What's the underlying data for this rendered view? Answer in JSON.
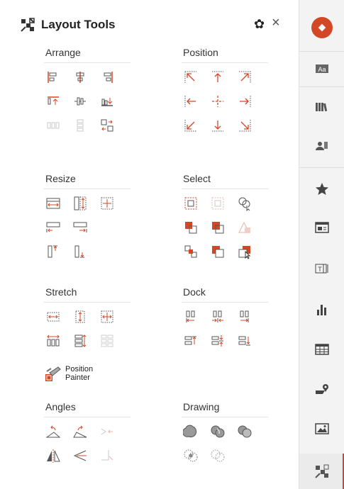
{
  "header": {
    "title": "Layout Tools",
    "logo_icon": "layout-tools-icon",
    "settings_icon": "gear-icon",
    "close_icon": "close-icon",
    "close_glyph": "×",
    "gear_glyph": "✿"
  },
  "colors": {
    "accent": "#d24726",
    "icon_gray": "#555555",
    "disabled": "#c8c8c8"
  },
  "sections": {
    "arrange": {
      "title": "Arrange"
    },
    "position": {
      "title": "Position"
    },
    "resize": {
      "title": "Resize"
    },
    "select": {
      "title": "Select"
    },
    "stretch": {
      "title": "Stretch"
    },
    "dock": {
      "title": "Dock"
    },
    "angles": {
      "title": "Angles"
    },
    "drawing": {
      "title": "Drawing"
    }
  },
  "position_painter": {
    "line1": "Position",
    "line2": "Painter"
  },
  "rail": {
    "items": [
      "addin-icon",
      "text-styles-icon",
      "library-icon",
      "people-icon",
      "star-icon",
      "card-icon",
      "text-box-icon",
      "chart-icon",
      "table-icon",
      "map-icon",
      "image-icon",
      "layout-tools-icon"
    ]
  }
}
